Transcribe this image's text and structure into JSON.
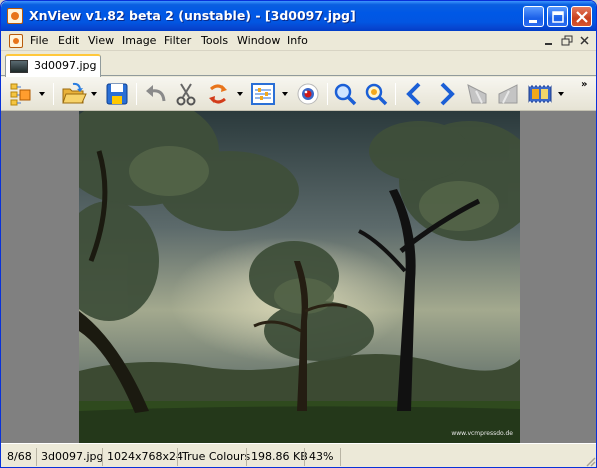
{
  "window": {
    "title": "XnView v1.82 beta 2 (unstable)  - [3d0097.jpg]"
  },
  "menu": {
    "items": [
      "File",
      "Edit",
      "View",
      "Image",
      "Filter",
      "Tools",
      "Window",
      "Info"
    ]
  },
  "tabs": [
    {
      "label": "3d0097.jpg",
      "active": true
    }
  ],
  "toolbar": {
    "buttons": [
      "browser-icon",
      "open-icon",
      "save-icon",
      "undo-icon",
      "cut-icon",
      "rotate-icon",
      "adjust-icon",
      "red-eye-icon",
      "zoom-in-icon",
      "zoom-out-icon",
      "previous-icon",
      "next-icon",
      "first-icon",
      "last-icon",
      "slideshow-icon"
    ],
    "overflow": "»"
  },
  "image": {
    "watermark": "www.vcmpressdo.de"
  },
  "status": {
    "index": "8/68",
    "filename": "3d0097.jpg",
    "dimensions": "1024x768x24",
    "colour_mode": "True Colours",
    "file_size": "198.86 KB",
    "zoom": "43%"
  },
  "colors": {
    "titlebar": "#0058e6",
    "accent_blue": "#1b5fd6",
    "view_background": "#808080"
  }
}
